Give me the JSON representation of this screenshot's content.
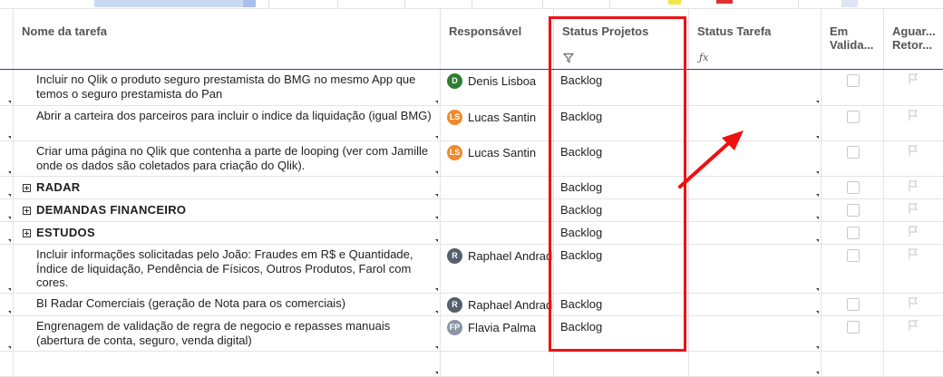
{
  "columns": {
    "task": "Nome da tarefa",
    "responsible": "Responsável",
    "status_projetos": "Status Projetos",
    "status_tarefa": "Status Tarefa",
    "em_validacao": "Em Valida...",
    "aguardando": "Aguar... Retor..."
  },
  "rows": [
    {
      "task": "Incluir no Qlik o produto seguro prestamista do BMG no mesmo App que temos o seguro prestamista do Pan",
      "initials": "D",
      "name": "Denis Lisboa",
      "avatar_color": "#2e7d32",
      "status": "Backlog"
    },
    {
      "task": "Abrir a carteira dos parceiros para incluir o indice da liquidação (igual BMG)",
      "initials": "LS",
      "name": "Lucas Santin",
      "avatar_color": "#ef8a2a",
      "status": "Backlog"
    },
    {
      "task": "Criar uma página no Qlik que contenha a parte de looping (ver com Jamille onde os dados são coletados para criação do Qlik).",
      "initials": "LS",
      "name": "Lucas Santin",
      "avatar_color": "#ef8a2a",
      "status": "Backlog"
    },
    {
      "task": "RADAR",
      "group": true,
      "status": "Backlog"
    },
    {
      "task": "DEMANDAS FINANCEIRO",
      "group": true,
      "status": "Backlog"
    },
    {
      "task": "ESTUDOS",
      "group": true,
      "status": "Backlog"
    },
    {
      "task": "Incluir informações solicitadas pelo João: Fraudes em R$ e Quantidade, Índice de liquidação, Pendência de Físicos, Outros Produtos, Farol com cores.",
      "initials": "R",
      "name": "Raphael Andrade",
      "avatar_color": "#54606b",
      "status": "Backlog"
    },
    {
      "task": "BI Radar Comerciais (geração de Nota para os comerciais)",
      "initials": "R",
      "name": "Raphael Andrade",
      "avatar_color": "#54606b",
      "status": "Backlog"
    },
    {
      "task": "Engrenagem de validação de regra de negocio e repasses manuais (abertura de conta, seguro, venda digital)",
      "initials": "FP",
      "name": "Flavia Palma",
      "avatar_color": "#8a95a3",
      "status": "Backlog"
    }
  ]
}
